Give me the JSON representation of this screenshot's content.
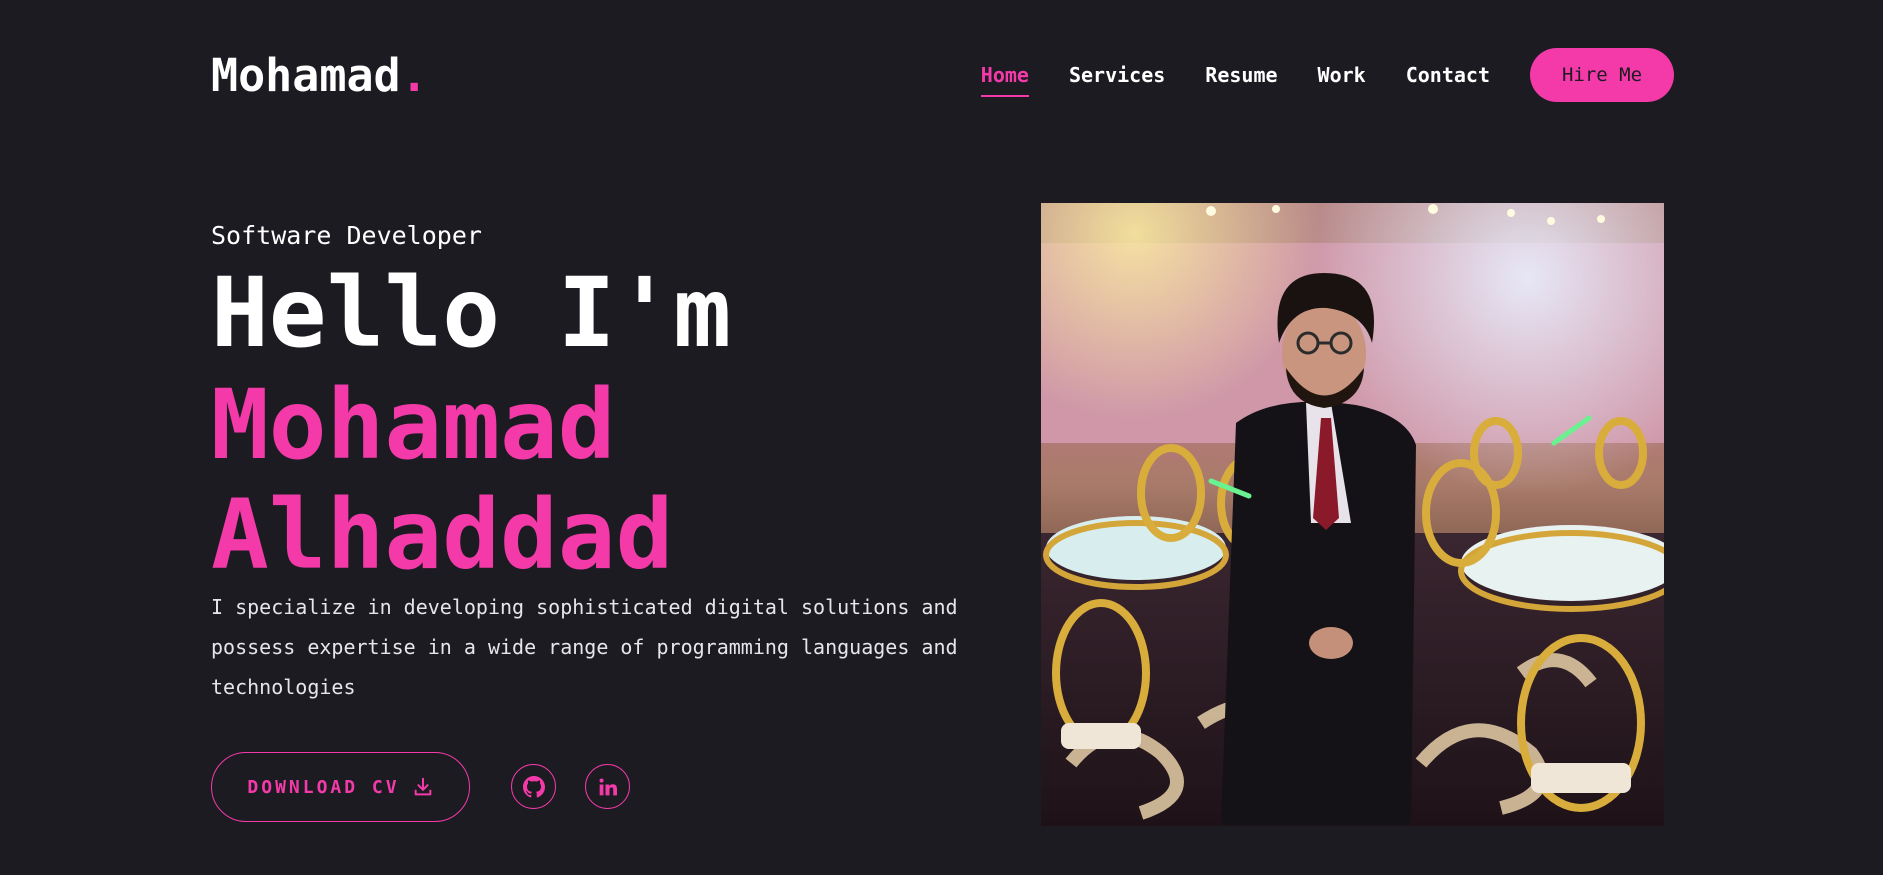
{
  "header": {
    "logo_text": "Mohamad",
    "logo_dot": ".",
    "nav": [
      {
        "label": "Home",
        "active": true
      },
      {
        "label": "Services",
        "active": false
      },
      {
        "label": "Resume",
        "active": false
      },
      {
        "label": "Work",
        "active": false
      },
      {
        "label": "Contact",
        "active": false
      }
    ],
    "hire_button": "Hire Me"
  },
  "hero": {
    "role": "Software Developer",
    "greeting": "Hello I'm",
    "first_name": "Mohamad",
    "last_name": "Alhaddad",
    "bio": "I specialize in developing sophisticated digital solutions and possess expertise in a wide range of programming languages and technologies",
    "download_button": "DOWNLOAD CV",
    "download_icon": "download-icon",
    "social": [
      {
        "name": "github-icon"
      },
      {
        "name": "linkedin-icon"
      }
    ]
  },
  "colors": {
    "background": "#1c1b22",
    "accent": "#f33aa8",
    "text": "#ffffff"
  }
}
